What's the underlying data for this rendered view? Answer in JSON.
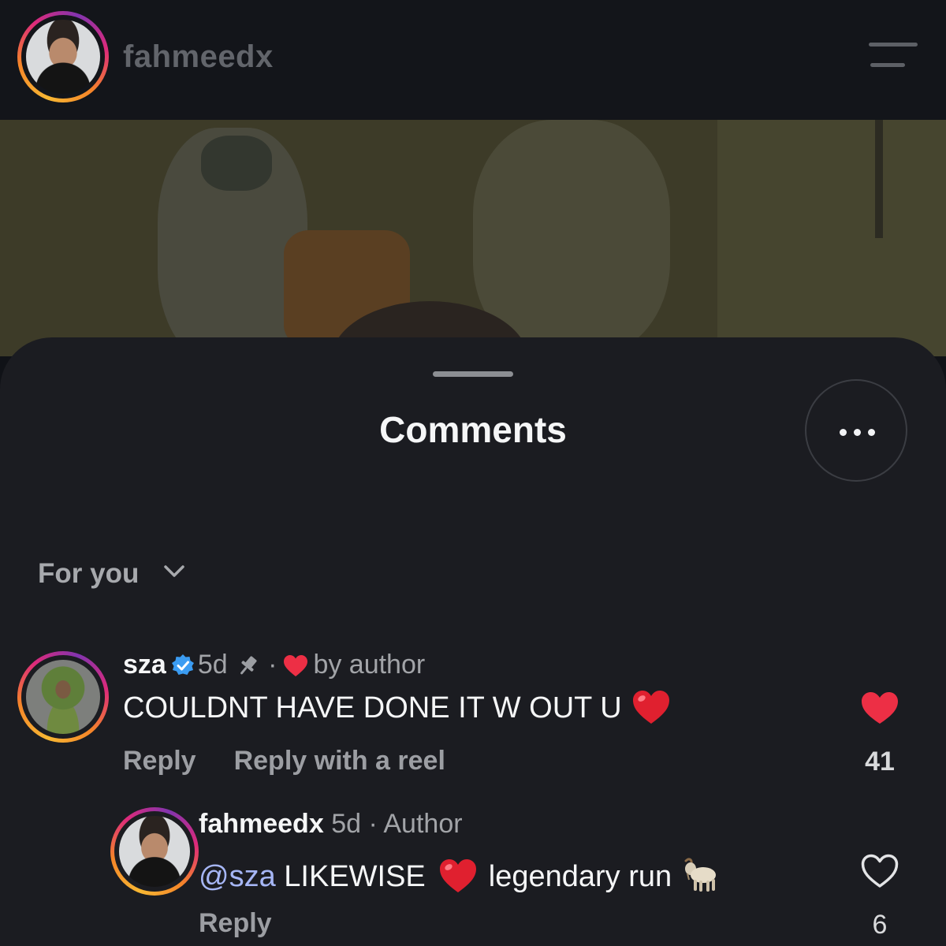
{
  "header": {
    "username": "fahmeedx",
    "avatar_icon": "profile-photo",
    "menu_icon": "hamburger-menu-icon"
  },
  "sheet": {
    "title": "Comments",
    "more_icon": "ellipsis-icon",
    "sort_label": "For you"
  },
  "comments": [
    {
      "username": "sza",
      "verified": true,
      "time": "5d",
      "pinned": true,
      "separator": "·",
      "liked_by": "by author",
      "text": "COULDNT HAVE DONE IT W OUT U",
      "emoji": "red-heart",
      "reply_label": "Reply",
      "reply_reel_label": "Reply with a reel",
      "likes": "41",
      "liked": true,
      "accent": "#ed4956"
    },
    {
      "username": "fahmeedx",
      "time": "5d",
      "separator": "·",
      "badge": "Author",
      "mention": "@sza",
      "text_a": "LIKEWISE",
      "text_b": "legendary run",
      "reply_label": "Reply",
      "likes": "6",
      "liked": false
    }
  ],
  "colors": {
    "background": "#1b1c21",
    "like_red": "#ed4956",
    "mention_blue": "#a6b6f5",
    "verified_blue": "#3b9cf2"
  }
}
